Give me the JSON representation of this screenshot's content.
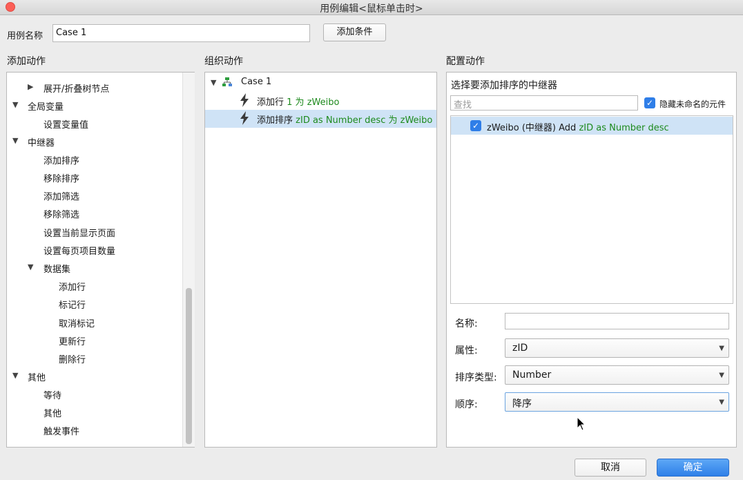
{
  "window": {
    "title": "用例编辑<鼠标单击时>"
  },
  "case_name": {
    "label": "用例名称",
    "value": "Case 1",
    "add_condition": "添加条件"
  },
  "left": {
    "title": "添加动作",
    "items": {
      "expand_tree": "展开/折叠树节点",
      "global_var": "全局变量",
      "set_var": "设置变量值",
      "repeater": "中继器",
      "add_sort": "添加排序",
      "remove_sort": "移除排序",
      "add_filter": "添加筛选",
      "remove_filter": "移除筛选",
      "set_page": "设置当前显示页面",
      "set_per_page": "设置每页项目数量",
      "dataset": "数据集",
      "add_row": "添加行",
      "mark_row": "标记行",
      "unmark": "取消标记",
      "update_row": "更新行",
      "delete_row": "删除行",
      "other": "其他",
      "wait": "等待",
      "other2": "其他",
      "fire_event": "触发事件"
    }
  },
  "middle": {
    "title": "组织动作",
    "case_label": "Case 1",
    "action1": {
      "verb": "添加行",
      "detail": "1 为 zWeibo"
    },
    "action2": {
      "verb": "添加排序",
      "detail": "zID as Number desc 为 zWeibo"
    }
  },
  "right": {
    "title": "配置动作",
    "subtitle": "选择要添加排序的中继器",
    "search_placeholder": "查找",
    "hide_unnamed": "隐藏未命名的元件",
    "repeater_row": {
      "prefix": "zWeibo (中继器) Add",
      "detail": "zID as Number desc"
    },
    "name_label": "名称:",
    "name_value": "",
    "attr_label": "属性:",
    "attr_value": "zID",
    "sort_type_label": "排序类型:",
    "sort_type_value": "Number",
    "order_label": "顺序:",
    "order_value": "降序"
  },
  "footer": {
    "cancel": "取消",
    "ok": "确定"
  }
}
